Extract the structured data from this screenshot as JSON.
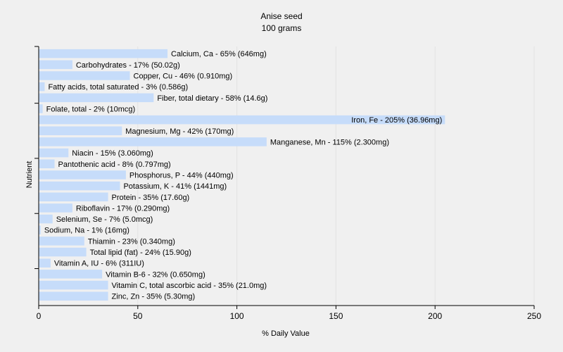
{
  "chart_data": {
    "type": "bar",
    "orientation": "horizontal",
    "title": "Anise seed",
    "subtitle": "100 grams",
    "xlabel": "% Daily Value",
    "ylabel": "Nutrient",
    "xlim": [
      0,
      250
    ],
    "xticks": [
      0,
      50,
      100,
      150,
      200,
      250
    ],
    "grid": true,
    "bar_color": "#c6dcfa",
    "grid_color": "#e2e2e2",
    "categories": [
      "Calcium, Ca",
      "Carbohydrates",
      "Copper, Cu",
      "Fatty acids, total saturated",
      "Fiber, total dietary",
      "Folate, total",
      "Iron, Fe",
      "Magnesium, Mg",
      "Manganese, Mn",
      "Niacin",
      "Pantothenic acid",
      "Phosphorus, P",
      "Potassium, K",
      "Protein",
      "Riboflavin",
      "Selenium, Se",
      "Sodium, Na",
      "Thiamin",
      "Total lipid (fat)",
      "Vitamin A, IU",
      "Vitamin B-6",
      "Vitamin C, total ascorbic acid",
      "Zinc, Zn"
    ],
    "values": [
      65,
      17,
      46,
      3,
      58,
      2,
      205,
      42,
      115,
      15,
      8,
      44,
      41,
      35,
      17,
      7,
      1,
      23,
      24,
      6,
      32,
      35,
      35
    ],
    "labels": [
      "Calcium, Ca - 65% (646mg)",
      "Carbohydrates - 17% (50.02g)",
      "Copper, Cu - 46% (0.910mg)",
      "Fatty acids, total saturated - 3% (0.586g)",
      "Fiber, total dietary - 58% (14.6g)",
      "Folate, total - 2% (10mcg)",
      "Iron, Fe - 205% (36.96mg)",
      "Magnesium, Mg - 42% (170mg)",
      "Manganese, Mn - 115% (2.300mg)",
      "Niacin - 15% (3.060mg)",
      "Pantothenic acid - 8% (0.797mg)",
      "Phosphorus, P - 44% (440mg)",
      "Potassium, K - 41% (1441mg)",
      "Protein - 35% (17.60g)",
      "Riboflavin - 17% (0.290mg)",
      "Selenium, Se - 7% (5.0mcg)",
      "Sodium, Na - 1% (16mg)",
      "Thiamin - 23% (0.340mg)",
      "Total lipid (fat) - 24% (15.90g)",
      "Vitamin A, IU - 6% (311IU)",
      "Vitamin B-6 - 32% (0.650mg)",
      "Vitamin C, total ascorbic acid - 35% (21.0mg)",
      "Zinc, Zn - 35% (5.30mg)"
    ]
  }
}
